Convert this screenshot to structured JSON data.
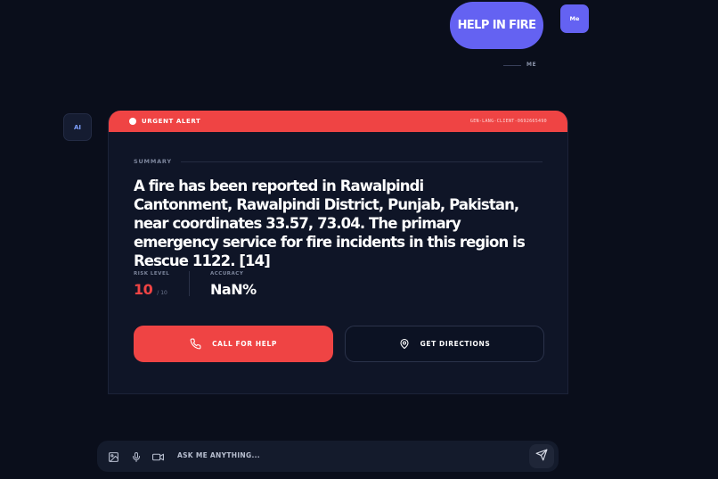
{
  "user_message": {
    "text": "HELP IN FIRE",
    "avatar": "Me",
    "label": "ME"
  },
  "ai": {
    "avatar": "AI"
  },
  "alert": {
    "title": "URGENT ALERT",
    "id": "GEN-LANG-CLIENT-0692665490",
    "summary_label": "SUMMARY",
    "summary": "A fire has been reported in Rawalpindi Cantonment, Rawalpindi District, Punjab, Pakistan, near coordinates 33.57, 73.04. The primary emergency service for fire incidents in this region is Rescue 1122. [14]",
    "risk_label": "RISK LEVEL",
    "risk_value": "10",
    "risk_max": "/ 10",
    "accuracy_label": "ACCURACY",
    "accuracy_value": "NaN%",
    "call_button": "CALL FOR HELP",
    "directions_button": "GET DIRECTIONS",
    "colors": {
      "alert": "#ef4444",
      "accent": "#6462f2"
    }
  },
  "input": {
    "placeholder": "ASK ME ANYTHING...",
    "icons": [
      "image-icon",
      "mic-icon",
      "video-icon",
      "send-icon"
    ]
  }
}
